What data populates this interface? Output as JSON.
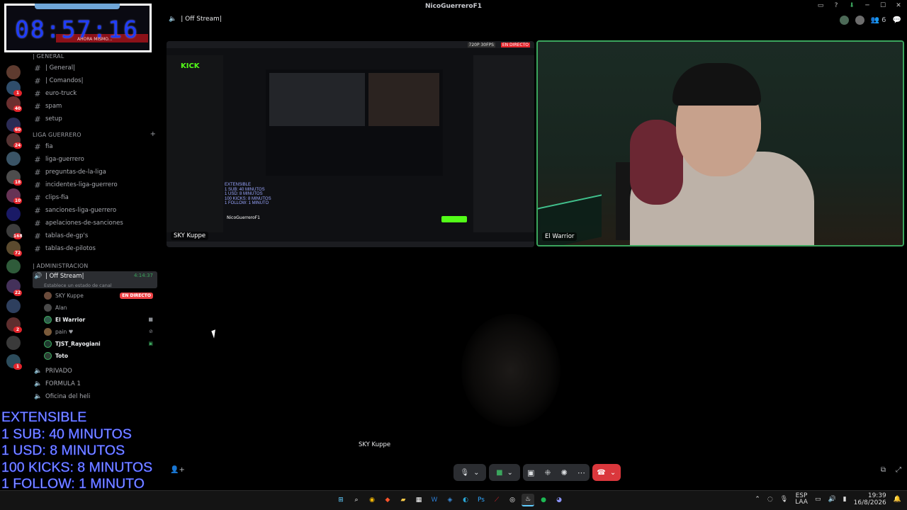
{
  "window": {
    "title": "NicoGuerreroF1"
  },
  "clock_overlay": {
    "time": "08:57:16",
    "subtitle": "AHORA MISMO..."
  },
  "extensible_overlay": {
    "lines": [
      "EXTENSIBLE",
      "1 SUB: 40 MINUTOS",
      "1 USD: 8 MINUTOS",
      "100 KICKS: 8 MINUTOS",
      "1 FOLLOW: 1 MINUTO"
    ]
  },
  "sidebar": {
    "cat_general": "| GENERAL",
    "general_channels": [
      "| General|",
      "| Comandos|",
      "euro-truck",
      "spam",
      "setup"
    ],
    "cat_liga": "LIGA GUERRERO",
    "liga_channels": [
      "fia",
      "liga-guerrero",
      "preguntas-de-la-liga",
      "incidentes-liga-guerrero",
      "clips-fia",
      "sanciones-liga-guerrero",
      "apelaciones-de-sanciones",
      "tablas-de-gp's",
      "tablas-de-pilotos"
    ],
    "cat_admin": "| ADMINISTRACION",
    "voice_channel": {
      "name": "| Off Stream|",
      "timer": "4:14:37",
      "status": "Establece un estado de canal"
    },
    "voice_users": [
      {
        "name": "SKY Kuppe",
        "badge": "EN DIRECTO"
      },
      {
        "name": "Alan"
      },
      {
        "name": "El Warrior"
      },
      {
        "name": "pain ♥"
      },
      {
        "name": "TJST_Rayogiani"
      },
      {
        "name": "Toto"
      }
    ],
    "other_voice": [
      "PRIVADO",
      "FORMULA 1",
      "Oficina del heli"
    ]
  },
  "server_badges": [
    "1",
    "40",
    "60",
    "24",
    "18",
    "10",
    "168",
    "72",
    "22",
    "2",
    "1"
  ],
  "call": {
    "title": "| Off Stream|",
    "participant_count": "6",
    "screen_tile_label": "SKY Kuppe",
    "cam_tile_label": "El Warrior",
    "speaker_name": "SKY Kuppe"
  },
  "screen_share": {
    "site_logo": "KICK",
    "quality_badge": "720P 30FPS",
    "live_badge": "EN DIRECTO",
    "streamer": "NicoGuerreroF1",
    "overlay_lines": [
      "EXTENSIBLE",
      "1 SUB: 40 MINUTOS",
      "1 USD: 8 MINUTOS",
      "100 KICKS: 8 MINUTOS",
      "1 FOLLOW: 1 MINUTO"
    ]
  },
  "taskbar": {
    "lang_top": "ESP",
    "lang_bottom": "LAA",
    "time": "19:39",
    "date": "16/8/2026"
  },
  "colors": {
    "accent_green": "#3ba55d",
    "end_call": "#da373c",
    "kick_green": "#53fc18",
    "overlay_blue": "#9aa6ff"
  }
}
